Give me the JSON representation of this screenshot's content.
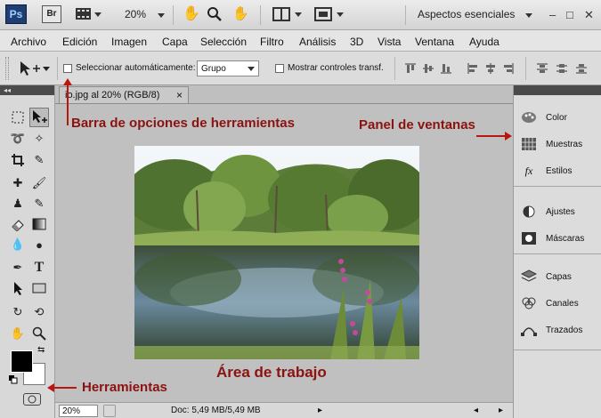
{
  "appbar": {
    "ps_logo": "Ps",
    "br_logo": "Br",
    "zoom": "20%",
    "workspace": "Aspectos esenciales",
    "window_controls": [
      "–",
      "□",
      "✕"
    ]
  },
  "menu": [
    "Archivo",
    "Edición",
    "Imagen",
    "Capa",
    "Selección",
    "Filtro",
    "Análisis",
    "3D",
    "Vista",
    "Ventana",
    "Ayuda"
  ],
  "options": {
    "auto_select_label": "Seleccionar automáticamente:",
    "auto_select_value": "Grupo",
    "transform_controls_label": "Mostrar controles transf."
  },
  "document": {
    "tab_title": "io.jpg al 20% (RGB/8)",
    "close_icon": "×",
    "zoom_value": "20%",
    "doc_info": "Doc: 5,49 MB/5,49 MB"
  },
  "panels": {
    "group1": [
      {
        "label": "Color",
        "icon": "palette-icon"
      },
      {
        "label": "Muestras",
        "icon": "swatches-icon"
      },
      {
        "label": "Estilos",
        "icon": "styles-icon"
      }
    ],
    "group2": [
      {
        "label": "Ajustes",
        "icon": "adjustments-icon"
      },
      {
        "label": "Máscaras",
        "icon": "masks-icon"
      }
    ],
    "group3": [
      {
        "label": "Capas",
        "icon": "layers-icon"
      },
      {
        "label": "Canales",
        "icon": "channels-icon"
      },
      {
        "label": "Trazados",
        "icon": "paths-icon"
      }
    ]
  },
  "annotations": {
    "options_bar": "Barra de opciones de herramientas",
    "window_panel": "Panel de ventanas",
    "work_area": "Área de trabajo",
    "tools": "Herramientas"
  },
  "colors": {
    "annotation": "#8b1210",
    "arrow": "#b8160f",
    "foreground": "#000000",
    "background": "#ffffff"
  }
}
